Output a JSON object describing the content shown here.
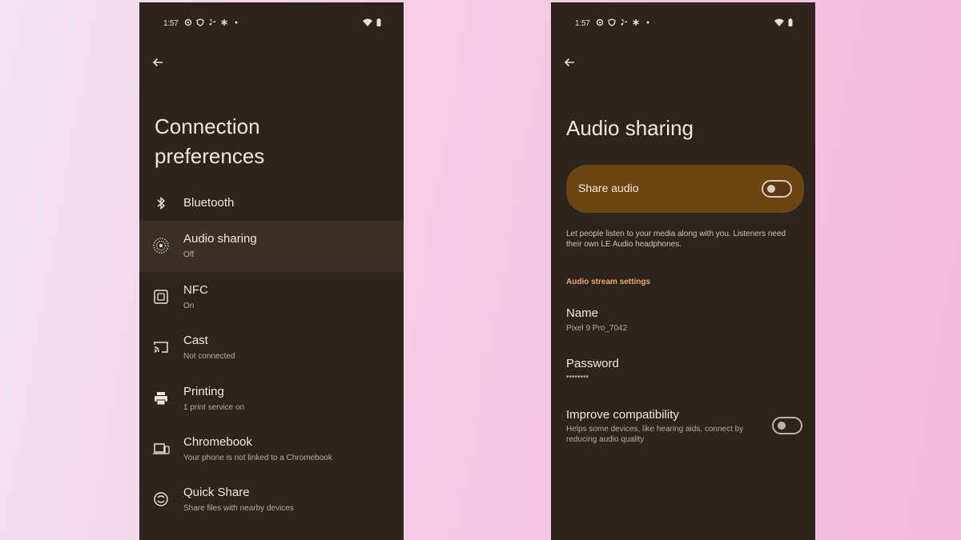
{
  "left_screen": {
    "status": {
      "time": "1:57"
    },
    "title_line1": "Connection",
    "title_line2": "preferences",
    "items": [
      {
        "label": "Bluetooth",
        "sub": "",
        "icon": "bluetooth-icon"
      },
      {
        "label": "Audio sharing",
        "sub": "Off",
        "icon": "audio-sharing-icon"
      },
      {
        "label": "NFC",
        "sub": "On",
        "icon": "nfc-icon"
      },
      {
        "label": "Cast",
        "sub": "Not connected",
        "icon": "cast-icon"
      },
      {
        "label": "Printing",
        "sub": "1 print service on",
        "icon": "printer-icon"
      },
      {
        "label": "Chromebook",
        "sub": "Your phone is not linked to a Chromebook",
        "icon": "chromebook-icon"
      },
      {
        "label": "Quick Share",
        "sub": "Share files with nearby devices",
        "icon": "quick-share-icon"
      }
    ]
  },
  "right_screen": {
    "status": {
      "time": "1:57"
    },
    "title": "Audio sharing",
    "share_audio": {
      "label": "Share audio",
      "enabled": false
    },
    "description": "Let people listen to your media along with you. Listeners need their own LE Audio headphones.",
    "section_title": "Audio stream settings",
    "name": {
      "label": "Name",
      "value": "Pixel 9 Pro_7042"
    },
    "password": {
      "label": "Password",
      "value": "••••••••"
    },
    "compat": {
      "label": "Improve compatibility",
      "value": "Helps some devices, like hearing aids, connect by reducing audio quality",
      "enabled": false
    }
  },
  "colors": {
    "background": "#2c241e",
    "card": "#6b4512",
    "accent": "#f0a868",
    "text": "#f0e8df",
    "muted": "#b7ada3"
  }
}
